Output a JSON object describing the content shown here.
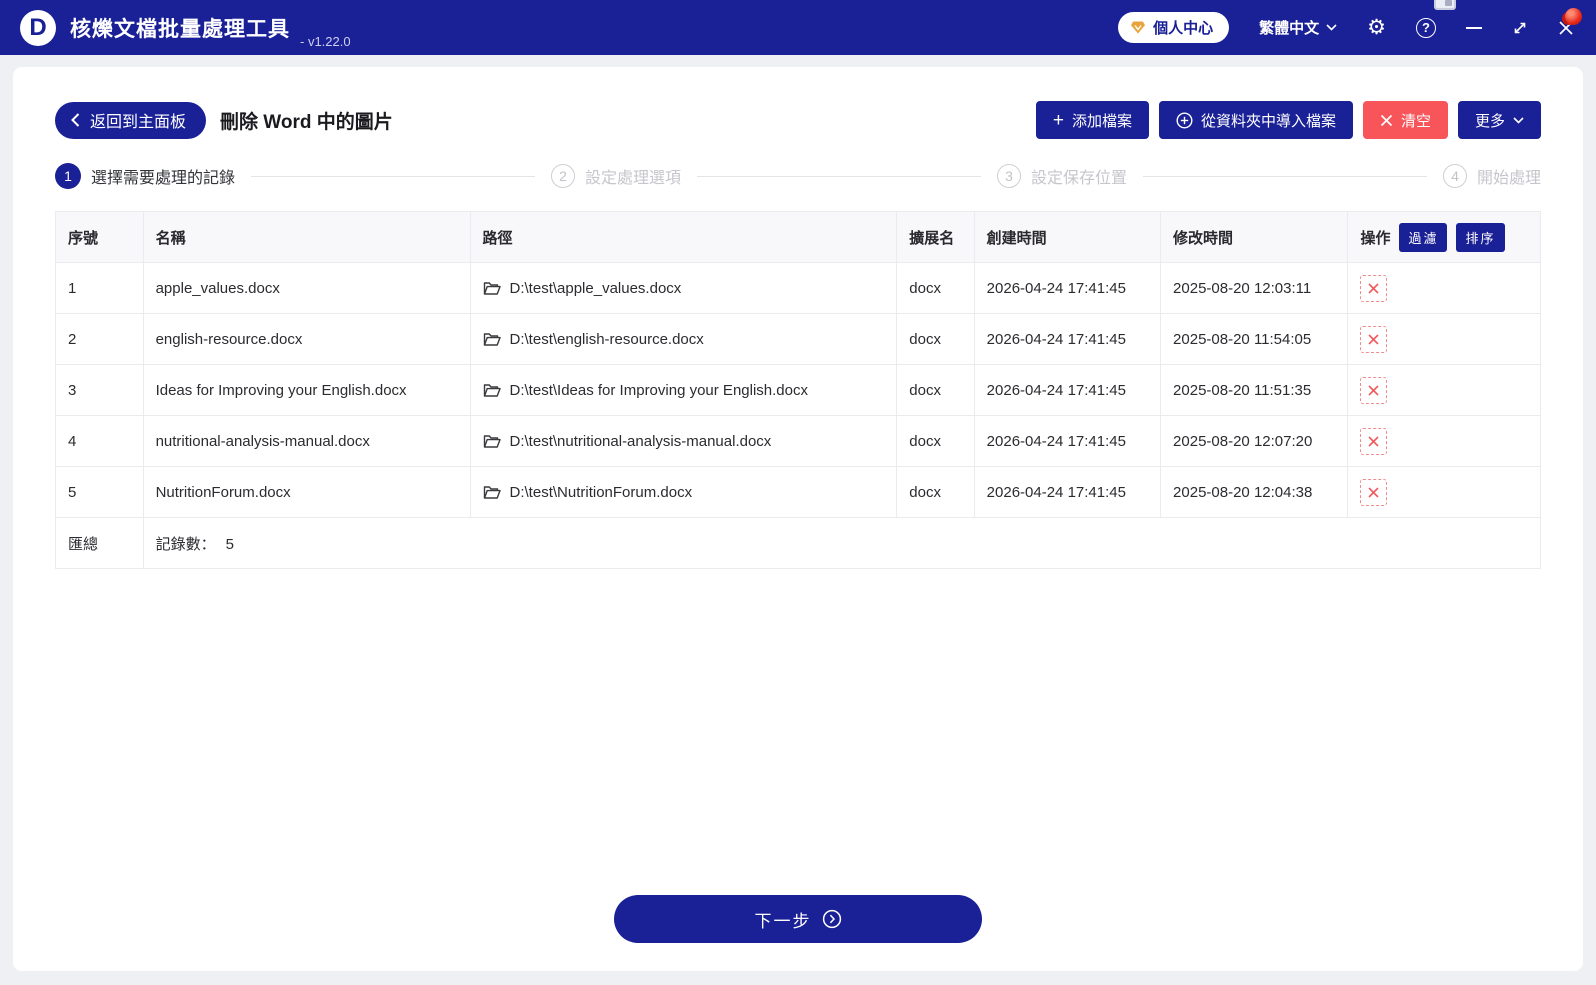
{
  "titlebar": {
    "logo_letter": "D",
    "app_title": "核爍文檔批量處理工具",
    "version": "- v1.22.0",
    "user_center_label": "個人中心",
    "language_label": "繁體中文",
    "gear_glyph": "⚙",
    "help_glyph": "?"
  },
  "toolbar": {
    "back_label": "返回到主面板",
    "page_title": "刪除 Word 中的圖片",
    "add_files_label": "添加檔案",
    "add_files_plus": "+",
    "import_folder_label": "從資料夾中導入檔案",
    "clear_label": "清空",
    "more_label": "更多"
  },
  "steps": [
    {
      "num": "1",
      "label": "選擇需要處理的記錄"
    },
    {
      "num": "2",
      "label": "設定處理選項"
    },
    {
      "num": "3",
      "label": "設定保存位置"
    },
    {
      "num": "4",
      "label": "開始處理"
    }
  ],
  "table": {
    "headers": {
      "index": "序號",
      "name": "名稱",
      "path": "路徑",
      "ext": "擴展名",
      "created": "創建時間",
      "modified": "修改時間",
      "actions": "操作"
    },
    "filter_label": "過濾",
    "sort_label": "排序",
    "rows": [
      {
        "index": "1",
        "name": "apple_values.docx",
        "path": "D:\\test\\apple_values.docx",
        "ext": "docx",
        "created": "2026-04-24 17:41:45",
        "modified": "2025-08-20 12:03:11"
      },
      {
        "index": "2",
        "name": "english-resource.docx",
        "path": "D:\\test\\english-resource.docx",
        "ext": "docx",
        "created": "2026-04-24 17:41:45",
        "modified": "2025-08-20 11:54:05"
      },
      {
        "index": "3",
        "name": "Ideas for Improving your English.docx",
        "path": "D:\\test\\Ideas for Improving your English.docx",
        "ext": "docx",
        "created": "2026-04-24 17:41:45",
        "modified": "2025-08-20 11:51:35"
      },
      {
        "index": "4",
        "name": "nutritional-analysis-manual.docx",
        "path": "D:\\test\\nutritional-analysis-manual.docx",
        "ext": "docx",
        "created": "2026-04-24 17:41:45",
        "modified": "2025-08-20 12:07:20"
      },
      {
        "index": "5",
        "name": "NutritionForum.docx",
        "path": "D:\\test\\NutritionForum.docx",
        "ext": "docx",
        "created": "2026-04-24 17:41:45",
        "modified": "2025-08-20 12:04:38"
      }
    ],
    "summary_label": "匯總",
    "summary_prefix": "記錄數：",
    "summary_value": "5"
  },
  "footer": {
    "next_label": "下一步"
  },
  "colors": {
    "brand_blue": "#1a2096",
    "danger_red": "#f7555a",
    "delete_icon_red": "#f05a5f",
    "gold_gem": "#e8a33d",
    "page_background": "#eff0f4"
  }
}
